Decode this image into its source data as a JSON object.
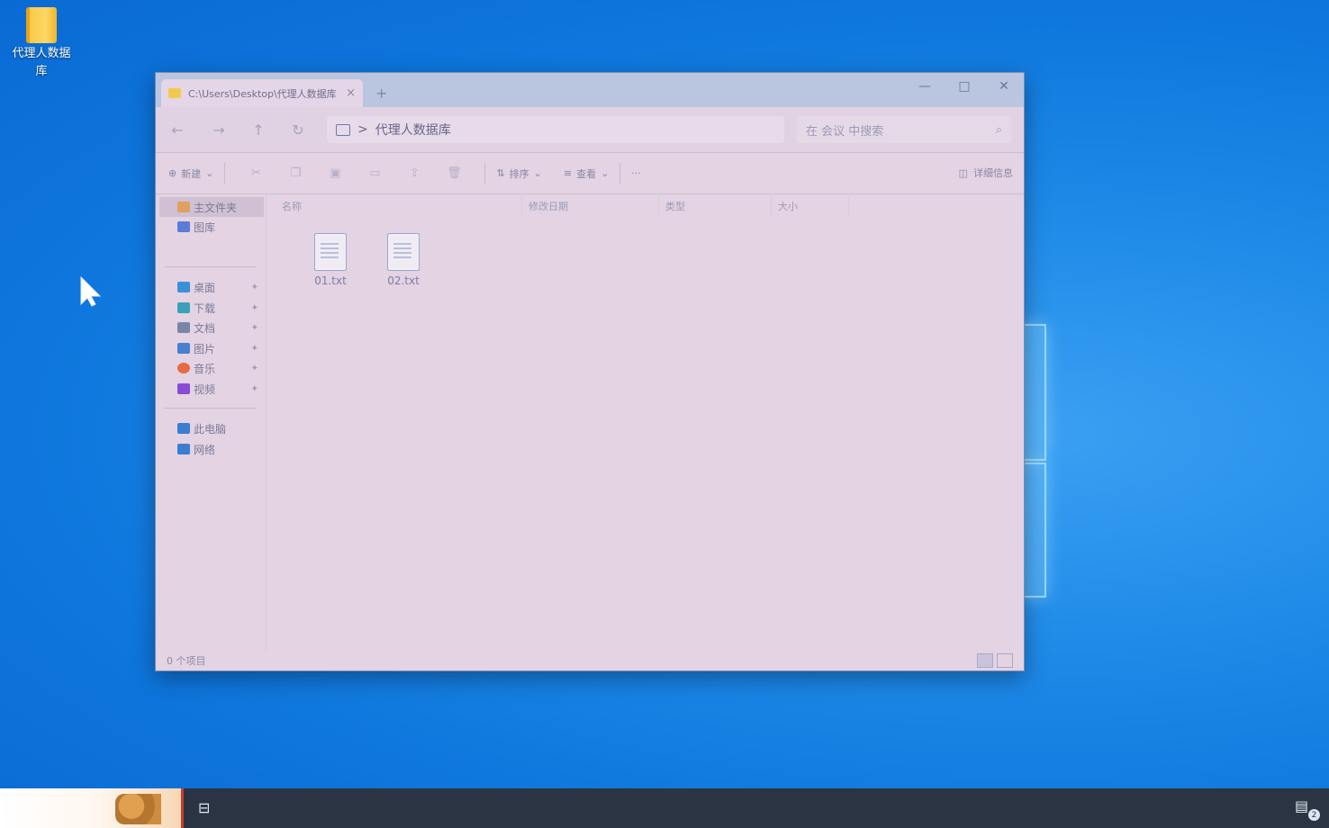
{
  "desktop": {
    "icon_label": "代理人数据库"
  },
  "explorer": {
    "tab_title": "C:\\Users\\Desktop\\代理人数据库",
    "tab_close": "×",
    "new_tab": "+",
    "window_controls": {
      "minimize": "—",
      "maximize": "□",
      "close": "✕"
    },
    "nav": {
      "back": "←",
      "forward": "→",
      "up": "↑",
      "refresh": "↻"
    },
    "address": {
      "separator": ">",
      "path": "代理人数据库"
    },
    "search": {
      "placeholder": "在 会议 中搜索",
      "icon": "⌕"
    },
    "toolbar": {
      "new_label": "新建",
      "sort_label": "排序",
      "view_label": "查看",
      "more_label": "···",
      "details_label": "详细信息"
    },
    "sidebar": {
      "items": [
        {
          "label": "主文件夹",
          "icon": "home-icon",
          "color": "#e0a060",
          "pinned": false
        },
        {
          "label": "图库",
          "icon": "gallery-icon",
          "color": "#5a7bd6",
          "pinned": false
        },
        {
          "label": "桌面",
          "icon": "desktop-icon",
          "color": "#3b8fd8",
          "pinned": true
        },
        {
          "label": "下载",
          "icon": "download-icon",
          "color": "#3aa0b8",
          "pinned": true
        },
        {
          "label": "文档",
          "icon": "documents-icon",
          "color": "#7a86a6",
          "pinned": true
        },
        {
          "label": "图片",
          "icon": "pictures-icon",
          "color": "#4a7fd0",
          "pinned": true
        },
        {
          "label": "音乐",
          "icon": "music-icon",
          "color": "#e86a40",
          "pinned": true
        },
        {
          "label": "视频",
          "icon": "video-icon",
          "color": "#8a4cd6",
          "pinned": true
        },
        {
          "label": "此电脑",
          "icon": "pc-icon",
          "color": "#3b7ed0",
          "pinned": false
        },
        {
          "label": "网络",
          "icon": "network-icon",
          "color": "#3b7ed0",
          "pinned": false
        }
      ],
      "pin_glyph": "📌"
    },
    "columns": [
      "名称",
      "修改日期",
      "类型",
      "大小"
    ],
    "files": [
      {
        "name": "01.txt"
      },
      {
        "name": "02.txt"
      }
    ],
    "status": "0 个项目"
  },
  "taskbar": {
    "task_view_glyph": "⊟",
    "notification_glyph": "▤",
    "notification_count": "2"
  }
}
